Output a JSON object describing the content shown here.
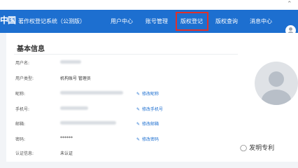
{
  "header": {
    "logo_text": "中国",
    "system_title": "著作权登记系统（公测版）",
    "nav": [
      {
        "label": "用户中心"
      },
      {
        "label": "账号管理"
      },
      {
        "label": "版权登记"
      },
      {
        "label": "版权查询"
      },
      {
        "label": "消息中心"
      }
    ],
    "highlighted_nav": "版权登记",
    "scroll_up_icon": "chevron-up-icon"
  },
  "info": {
    "title": "基本信息",
    "fields": [
      {
        "label": "用户名:",
        "value": ""
      },
      {
        "label": "用户类型:",
        "value": "机构账号 管理员"
      },
      {
        "label": "昵称:",
        "value": "",
        "edit": "修改昵称"
      },
      {
        "label": "手机号:",
        "value": "",
        "edit": "修改手机号"
      },
      {
        "label": "邮箱:",
        "value": "",
        "edit": "修改邮箱"
      },
      {
        "label": "密码:",
        "value": "******",
        "edit": "修改密码"
      },
      {
        "label": "认证信息:",
        "value": "未认证"
      }
    ]
  },
  "watermark": {
    "text": "发明专利"
  },
  "colors": {
    "nav_bg": "#1d6fd0",
    "highlight": "#e0302a",
    "link": "#1d6fd0"
  }
}
